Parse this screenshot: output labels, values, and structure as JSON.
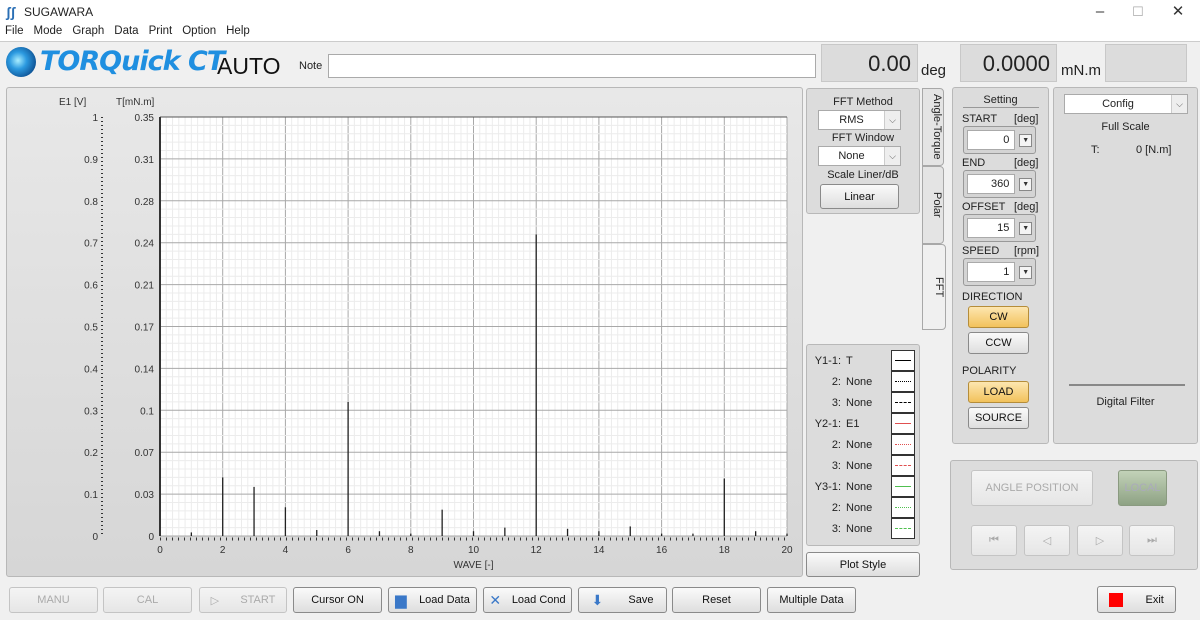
{
  "window": {
    "title": "SUGAWARA",
    "min": "–",
    "max": "☐",
    "close": "✕"
  },
  "menu": [
    "File",
    "Mode",
    "Graph",
    "Data",
    "Print",
    "Option",
    "Help"
  ],
  "brand": {
    "name": "TORQuick CT",
    "mode": "AUTO",
    "note_label": "Note",
    "note_value": ""
  },
  "readouts": {
    "angle": "0.00",
    "angle_unit": "deg",
    "torque": "0.0000",
    "torque_unit": "mN.m",
    "extra": ""
  },
  "fft": {
    "method_label": "FFT Method",
    "method": "RMS",
    "window_label": "FFT Window",
    "window": "None",
    "scale_label": "Scale Liner/dB",
    "scale_button": "Linear"
  },
  "tabs": [
    "Angle-Torque",
    "Polar",
    "FFT"
  ],
  "legend": [
    {
      "name": "Y1-1:",
      "value": "T",
      "color": "#000000",
      "style": "solid"
    },
    {
      "name": "2:",
      "value": "None",
      "color": "#000000",
      "style": "dotted"
    },
    {
      "name": "3:",
      "value": "None",
      "color": "#000000",
      "style": "dashed"
    },
    {
      "name": "Y2-1:",
      "value": "E1",
      "color": "#e05050",
      "style": "solid"
    },
    {
      "name": "2:",
      "value": "None",
      "color": "#e05050",
      "style": "dotted"
    },
    {
      "name": "3:",
      "value": "None",
      "color": "#e05050",
      "style": "dashed"
    },
    {
      "name": "Y3-1:",
      "value": "None",
      "color": "#50c050",
      "style": "solid"
    },
    {
      "name": "2:",
      "value": "None",
      "color": "#50c050",
      "style": "dotted"
    },
    {
      "name": "3:",
      "value": "None",
      "color": "#50c050",
      "style": "dashed"
    }
  ],
  "plot_style_button": "Plot Style",
  "setting": {
    "title": "Setting",
    "fields": [
      {
        "label": "START",
        "unit": "[deg]",
        "value": "0"
      },
      {
        "label": "END",
        "unit": "[deg]",
        "value": "360"
      },
      {
        "label": "OFFSET",
        "unit": "[deg]",
        "value": "15"
      },
      {
        "label": "SPEED",
        "unit": "[rpm]",
        "value": "1"
      }
    ],
    "direction_label": "DIRECTION",
    "cw": "CW",
    "ccw": "CCW",
    "polarity_label": "POLARITY",
    "load": "LOAD",
    "source": "SOURCE"
  },
  "config": {
    "select": "Config",
    "full_scale_label": "Full Scale",
    "t_label": "T:",
    "t_value": "0 [N.m]",
    "digital_filter": "Digital Filter"
  },
  "position": {
    "angle_position": "ANGLE POSITION",
    "local": "LOCAL",
    "nav": [
      "⏮",
      "◁",
      "▷",
      "⏭"
    ]
  },
  "bottom": {
    "manu": "MANU",
    "cal": "CAL",
    "start": "START",
    "cursor": "Cursor ON",
    "load_data": "Load Data",
    "load_cond": "Load Cond",
    "save": "Save",
    "reset": "Reset",
    "multiple": "Multiple Data",
    "exit": "Exit"
  },
  "chart_data": {
    "type": "bar",
    "title": "",
    "xlabel": "WAVE [-]",
    "ylabel_left": "E1 [V]",
    "ylabel_right": "T[mN.m]",
    "xlim": [
      0,
      20
    ],
    "xticks": [
      "0",
      "2",
      "4",
      "6",
      "8",
      "10",
      "12",
      "14",
      "16",
      "18",
      "20"
    ],
    "y1_ticks": [
      "1",
      "0.9",
      "0.8",
      "0.7",
      "0.6",
      "0.5",
      "0.4",
      "0.3",
      "0.2",
      "0.1",
      "0"
    ],
    "y2_ticks": [
      "0.35",
      "0.31",
      "0.28",
      "0.24",
      "0.21",
      "0.17",
      "0.14",
      "0.1",
      "0.07",
      "0.03",
      "0"
    ],
    "ylim": [
      0,
      0.35
    ],
    "grid": true,
    "series": [
      {
        "name": "T",
        "x": [
          1,
          2,
          3,
          4,
          5,
          6,
          7,
          8,
          9,
          10,
          11,
          12,
          13,
          14,
          15,
          16,
          17,
          18,
          19,
          20
        ],
        "values": [
          0.003,
          0.049,
          0.041,
          0.024,
          0.005,
          0.112,
          0.004,
          0.002,
          0.022,
          0.004,
          0.007,
          0.252,
          0.006,
          0.004,
          0.008,
          0.002,
          0.002,
          0.048,
          0.004,
          0.002
        ]
      }
    ]
  }
}
